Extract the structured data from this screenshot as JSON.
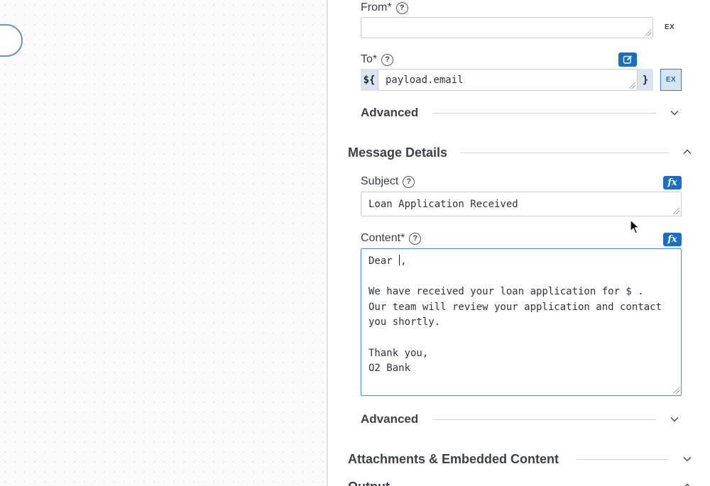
{
  "form": {
    "from": {
      "label": "From*",
      "value": "",
      "ex_label": "EX"
    },
    "to": {
      "label": "To*",
      "prefix": "${",
      "value": "payload.email",
      "suffix": "}",
      "ex_label": "EX",
      "edit_icon": "edit-square-icon"
    },
    "advanced_1": {
      "label": "Advanced",
      "state": "collapsed"
    }
  },
  "message_details": {
    "title": "Message Details",
    "state": "expanded",
    "subject": {
      "label": "Subject",
      "value": "Loan Application Received",
      "fx_label": "fx"
    },
    "content": {
      "label": "Content*",
      "fx_label": "fx",
      "lines": [
        "Dear ",
        "",
        "We have received your loan application for $ .",
        "Our team will review your application and contact",
        "you shortly.",
        "",
        "Thank you,",
        "O2 Bank"
      ],
      "line1_after_caret": ","
    },
    "advanced": {
      "label": "Advanced",
      "state": "collapsed"
    }
  },
  "attachments": {
    "title": "Attachments & Embedded Content",
    "state": "collapsed"
  },
  "output": {
    "title": "Output"
  },
  "colors": {
    "accent": "#1b6ec2",
    "expression_bg": "#d9e4f1",
    "focus_border": "#5b8fd0"
  }
}
